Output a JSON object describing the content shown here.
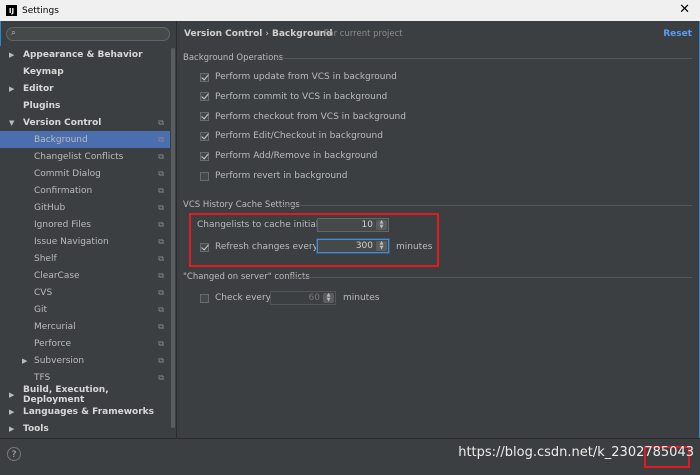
{
  "window": {
    "title": "Settings",
    "close": "✕"
  },
  "search": {
    "icon": "search-icon"
  },
  "sidebar": {
    "items": [
      {
        "label": "Appearance & Behavior",
        "arrow": "▶",
        "bold": true,
        "level": 0
      },
      {
        "label": "Keymap",
        "arrow": "",
        "bold": true,
        "level": 0
      },
      {
        "label": "Editor",
        "arrow": "▶",
        "bold": true,
        "level": 0
      },
      {
        "label": "Plugins",
        "arrow": "",
        "bold": true,
        "level": 0
      },
      {
        "label": "Version Control",
        "arrow": "▼",
        "bold": true,
        "level": 0,
        "proj": true
      },
      {
        "label": "Background",
        "arrow": "",
        "level": 1,
        "selected": true,
        "proj": true
      },
      {
        "label": "Changelist Conflicts",
        "arrow": "",
        "level": 1,
        "proj": true
      },
      {
        "label": "Commit Dialog",
        "arrow": "",
        "level": 1,
        "proj": true
      },
      {
        "label": "Confirmation",
        "arrow": "",
        "level": 1,
        "proj": true
      },
      {
        "label": "GitHub",
        "arrow": "",
        "level": 1,
        "proj": true
      },
      {
        "label": "Ignored Files",
        "arrow": "",
        "level": 1,
        "proj": true
      },
      {
        "label": "Issue Navigation",
        "arrow": "",
        "level": 1,
        "proj": true
      },
      {
        "label": "Shelf",
        "arrow": "",
        "level": 1,
        "proj": true
      },
      {
        "label": "ClearCase",
        "arrow": "",
        "level": 1,
        "proj": true
      },
      {
        "label": "CVS",
        "arrow": "",
        "level": 1,
        "proj": true
      },
      {
        "label": "Git",
        "arrow": "",
        "level": 1,
        "proj": true
      },
      {
        "label": "Mercurial",
        "arrow": "",
        "level": 1,
        "proj": true
      },
      {
        "label": "Perforce",
        "arrow": "",
        "level": 1,
        "proj": true
      },
      {
        "label": "Subversion",
        "arrow": "▶",
        "level": 1,
        "proj": true
      },
      {
        "label": "TFS",
        "arrow": "",
        "level": 1,
        "proj": true
      },
      {
        "label": "Build, Execution, Deployment",
        "arrow": "▶",
        "bold": true,
        "level": 0
      },
      {
        "label": "Languages & Frameworks",
        "arrow": "▶",
        "bold": true,
        "level": 0
      },
      {
        "label": "Tools",
        "arrow": "▶",
        "bold": true,
        "level": 0
      }
    ]
  },
  "header": {
    "crumb1": "Version Control",
    "sep": "›",
    "crumb2": "Background",
    "project_note": "For current project",
    "reset": "Reset"
  },
  "background_ops": {
    "title": "Background Operations",
    "options": [
      {
        "label": "Perform update from VCS in background",
        "checked": true
      },
      {
        "label": "Perform commit to VCS in background",
        "checked": true
      },
      {
        "label": "Perform checkout from VCS in background",
        "checked": true
      },
      {
        "label": "Perform Edit/Checkout in background",
        "checked": true
      },
      {
        "label": "Perform Add/Remove in background",
        "checked": true
      },
      {
        "label": "Perform revert in background",
        "checked": false
      }
    ]
  },
  "cache": {
    "title": "VCS History Cache Settings",
    "changelists_label": "Changelists to cache initially:",
    "changelists_value": "10",
    "refresh_label": "Refresh changes every",
    "refresh_checked": true,
    "refresh_value": "300",
    "refresh_unit": "minutes"
  },
  "conflicts": {
    "title": "\"Changed on server\" conflicts",
    "check_label": "Check every",
    "check_checked": false,
    "check_value": "60",
    "check_unit": "minutes"
  },
  "footer": {
    "help": "?",
    "watermark": "https://blog.csdn.net/k_2302785043"
  }
}
